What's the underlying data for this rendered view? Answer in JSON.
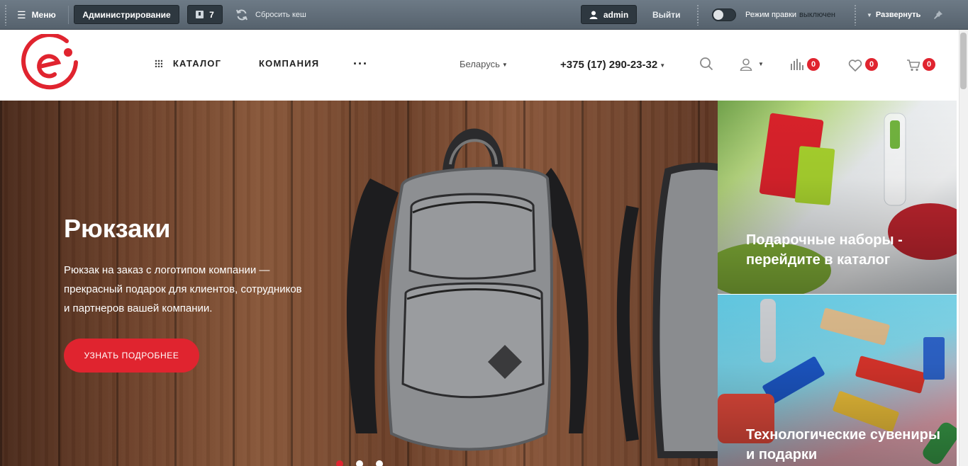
{
  "admin_panel": {
    "menu_label": "Меню",
    "administration_label": "Администрирование",
    "notifications_count": "7",
    "clear_cache_label": "Сбросить кеш",
    "user_label": "admin",
    "logout_label": "Выйти",
    "edit_mode_label": "Режим правки",
    "edit_mode_state": "выключен",
    "expand_label": "Развернуть"
  },
  "header": {
    "nav": {
      "catalog": "КАТАЛОГ",
      "company": "КОМПАНИЯ",
      "more": "···"
    },
    "region": "Беларусь",
    "phone": "+375 (17) 290-23-32",
    "compare_count": "0",
    "favorites_count": "0",
    "cart_count": "0"
  },
  "hero": {
    "title": "Рюкзаки",
    "text": "Рюкзак на заказ с логотипом компании — прекрасный подарок для клиентов, сотрудников и партнеров вашей компании.",
    "button_label": "УЗНАТЬ ПОДРОБНЕЕ",
    "slide_count": 3,
    "active_slide": 1
  },
  "banners": [
    {
      "title": "Подарочные наборы - перейдите в каталог"
    },
    {
      "title": "Технологические сувениры и подарки"
    }
  ],
  "colors": {
    "accent": "#e0242f",
    "admin_bar": "#5f6b76"
  }
}
